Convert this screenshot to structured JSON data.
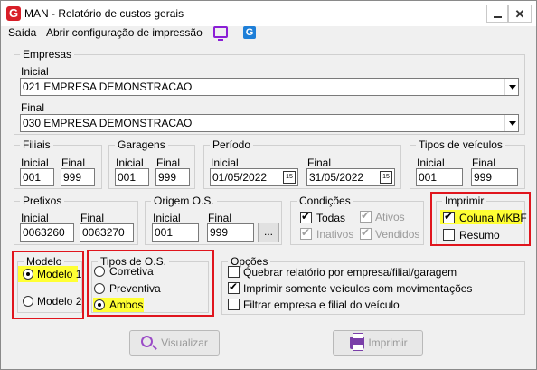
{
  "window": {
    "title": "MAN -  Relatório de custos gerais",
    "icon": "G",
    "close_glyph": "✕"
  },
  "menu": {
    "items": [
      "Saída",
      "Abrir configuração de impressão"
    ],
    "tool_icons": [
      "monitor-icon",
      "g-app-icon"
    ],
    "tool_icon_glyph": "G"
  },
  "empresas": {
    "legend": "Empresas",
    "inicial_label": "Inicial",
    "inicial_value": "021 EMPRESA DEMONSTRACAO",
    "final_label": "Final",
    "final_value": "030 EMPRESA DEMONSTRACAO"
  },
  "filiais": {
    "legend": "Filiais",
    "inicial_label": "Inicial",
    "inicial_value": "001",
    "final_label": "Final",
    "final_value": "999"
  },
  "garagens": {
    "legend": "Garagens",
    "inicial_label": "Inicial",
    "inicial_value": "001",
    "final_label": "Final",
    "final_value": "999"
  },
  "periodo": {
    "legend": "Período",
    "inicial_label": "Inicial",
    "inicial_value": "01/05/2022",
    "final_label": "Final",
    "final_value": "31/05/2022",
    "cal_glyph": "15"
  },
  "tipos_veiculos": {
    "legend": "Tipos de veículos",
    "inicial_label": "Inicial",
    "inicial_value": "001",
    "final_label": "Final",
    "final_value": "999"
  },
  "prefixos": {
    "legend": "Prefixos",
    "inicial_label": "Inicial",
    "inicial_value": "0063260",
    "final_label": "Final",
    "final_value": "0063270"
  },
  "origem_os": {
    "legend": "Origem O.S.",
    "inicial_label": "Inicial",
    "inicial_value": "001",
    "final_label": "Final",
    "final_value": "999",
    "browse_label": "..."
  },
  "condicoes": {
    "legend": "Condições",
    "options": [
      {
        "label": "Todas",
        "checked": true,
        "enabled": true
      },
      {
        "label": "Ativos",
        "checked": true,
        "enabled": false
      },
      {
        "label": "Inativos",
        "checked": true,
        "enabled": false
      },
      {
        "label": "Vendidos",
        "checked": true,
        "enabled": false
      }
    ]
  },
  "imprimir": {
    "legend": "Imprimir",
    "options": [
      {
        "label": "Coluna MKBF",
        "checked": true
      },
      {
        "label": "Resumo",
        "checked": false
      }
    ]
  },
  "modelo": {
    "legend": "Modelo",
    "options": [
      {
        "label": "Modelo 1",
        "selected": true
      },
      {
        "label": "Modelo 2",
        "selected": false
      }
    ]
  },
  "tipos_os": {
    "legend": "Tipos de O.S.",
    "options": [
      {
        "label": "Corretiva",
        "selected": false
      },
      {
        "label": "Preventiva",
        "selected": false
      },
      {
        "label": "Ambos",
        "selected": true
      }
    ]
  },
  "opcoes": {
    "legend": "Opções",
    "options": [
      {
        "label": "Quebrar relatório por empresa/filial/garagem",
        "checked": false
      },
      {
        "label": "Imprimir somente veículos com movimentações",
        "checked": true
      },
      {
        "label": "Filtrar empresa e filial do veículo",
        "checked": false
      }
    ]
  },
  "buttons": {
    "visualizar": "Visualizar",
    "imprimir": "Imprimir"
  },
  "colors": {
    "highlight": "#ffff33",
    "annotation_box": "#e0151d",
    "accent": "#8b1fd6"
  }
}
